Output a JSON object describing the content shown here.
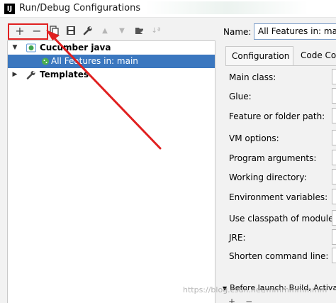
{
  "window": {
    "title": "Run/Debug Configurations",
    "app_icon_label": "IJ"
  },
  "toolbar": {
    "buttons": [
      {
        "name": "add",
        "icon": "plus-icon",
        "glyph": "+"
      },
      {
        "name": "remove",
        "icon": "minus-icon",
        "glyph": "−"
      },
      {
        "name": "copy",
        "icon": "copy-icon"
      },
      {
        "name": "save",
        "icon": "save-icon"
      },
      {
        "name": "edit-defaults",
        "icon": "wrench-icon"
      },
      {
        "name": "move-up",
        "icon": "arrow-up-icon",
        "glyph": "▲"
      },
      {
        "name": "move-down",
        "icon": "arrow-down-icon",
        "glyph": "▼"
      },
      {
        "name": "move-into-folder",
        "icon": "folder-add-icon"
      },
      {
        "name": "sort",
        "icon": "sort-icon",
        "glyph": "↓ª"
      }
    ]
  },
  "tree": {
    "items": [
      {
        "label": "Cucumber java",
        "bold": true,
        "expanded": true,
        "icon": "cucumber-icon"
      },
      {
        "label": "All Features in: main",
        "selected": true,
        "icon": "cucumber-config-icon"
      },
      {
        "label": "Templates",
        "bold": true,
        "expanded": false,
        "icon": "wrench-icon"
      }
    ]
  },
  "config": {
    "name_label": "Name:",
    "name_value": "All Features in: main",
    "tabs": [
      {
        "label": "Configuration",
        "active": true
      },
      {
        "label": "Code Cov",
        "active": false
      }
    ],
    "fields": [
      {
        "label": "Main class:"
      },
      {
        "label": "Glue:"
      },
      {
        "label": "Feature or folder path:"
      },
      {
        "label": "VM options:"
      },
      {
        "label": "Program arguments:"
      },
      {
        "label": "Working directory:"
      },
      {
        "label": "Environment variables:"
      },
      {
        "label": "Use classpath of module:"
      },
      {
        "label": "JRE:"
      },
      {
        "label": "Shorten command line:"
      }
    ],
    "before_launch": "Before launch: Build, Activate t"
  },
  "watermark": "https://blog.csdn.net/mmmmmmmm",
  "colors": {
    "selection": "#3b77bf",
    "annotation": "#e02020"
  }
}
